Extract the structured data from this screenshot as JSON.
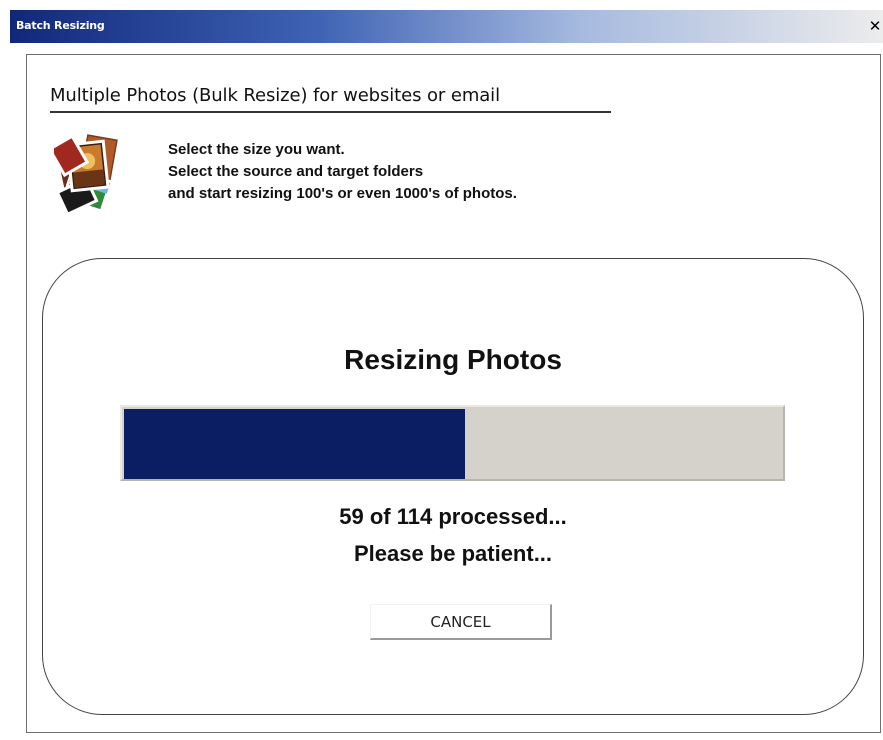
{
  "window": {
    "title": "Batch Resizing",
    "close_glyph": "✕"
  },
  "header": {
    "heading": "Multiple Photos (Bulk Resize) for websites or email",
    "icon": "photos-stack-icon",
    "description_lines": [
      "Select the size you want.",
      "Select the source and target folders",
      "and start resizing 100's or even 1000's of photos."
    ]
  },
  "progress_panel": {
    "title": "Resizing Photos",
    "processed": 59,
    "total": 114,
    "status_count": "59 of 114 processed...",
    "status_wait": "Please be patient...",
    "cancel_label": "CANCEL"
  },
  "colors": {
    "progress_fill": "#0b1e63",
    "progress_track": "#d5d2cb",
    "titlebar_start": "#11287a",
    "titlebar_end": "#ececec"
  }
}
